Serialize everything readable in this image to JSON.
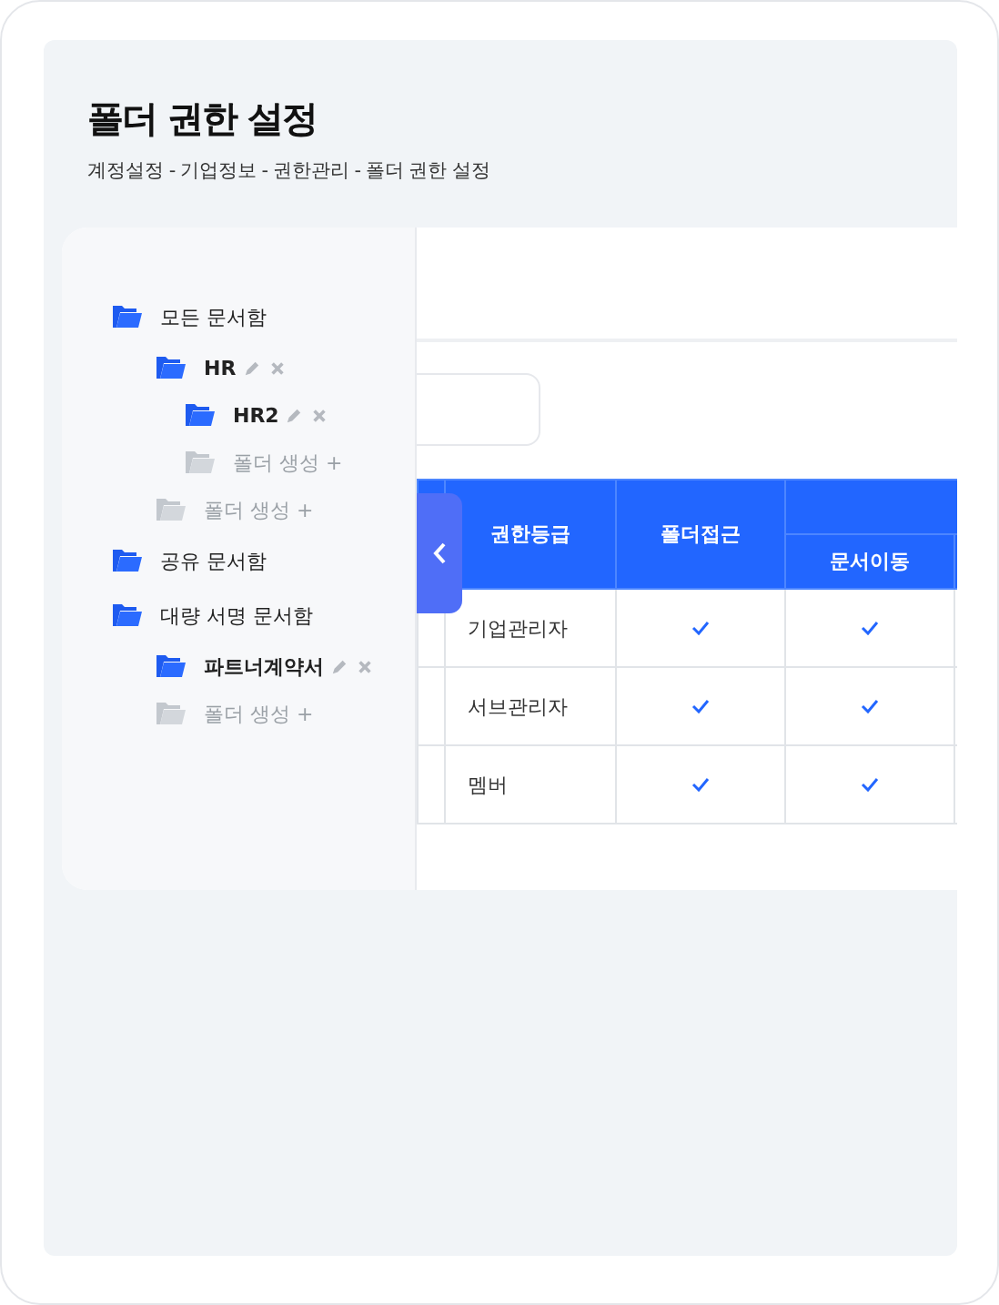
{
  "header": {
    "title": "폴더 권한 설정",
    "breadcrumb": "계정설정 - 기업정보 - 권한관리 - 폴더 권한 설정"
  },
  "tree": [
    {
      "kind": "folder",
      "label": "모든 문서함",
      "editable": false,
      "children": [
        {
          "kind": "folder",
          "label": "HR",
          "editable": true,
          "children": [
            {
              "kind": "folder",
              "label": "HR2",
              "editable": true
            },
            {
              "kind": "create",
              "label": "폴더 생성 +"
            }
          ]
        },
        {
          "kind": "create",
          "label": "폴더 생성 +"
        }
      ]
    },
    {
      "kind": "folder",
      "label": "공유 문서함",
      "editable": false
    },
    {
      "kind": "folder",
      "label": "대량 서명 문서함",
      "editable": false,
      "children": [
        {
          "kind": "folder",
          "label": "파트너계약서",
          "editable": true
        },
        {
          "kind": "create",
          "label": "폴더 생성 +"
        }
      ]
    }
  ],
  "table": {
    "columns": [
      "권한등급",
      "폴더접근"
    ],
    "group_subcolumns": [
      "문서이동"
    ],
    "rows": [
      {
        "grade": "기업관리자",
        "checks": [
          {
            "checked": true
          },
          {
            "checked": true
          }
        ]
      },
      {
        "grade": "서브관리자",
        "checks": [
          {
            "checked": true
          },
          {
            "checked": true
          }
        ]
      },
      {
        "grade": "멤버",
        "checks": [
          {
            "checked": true
          },
          {
            "checked": true
          }
        ]
      }
    ]
  }
}
